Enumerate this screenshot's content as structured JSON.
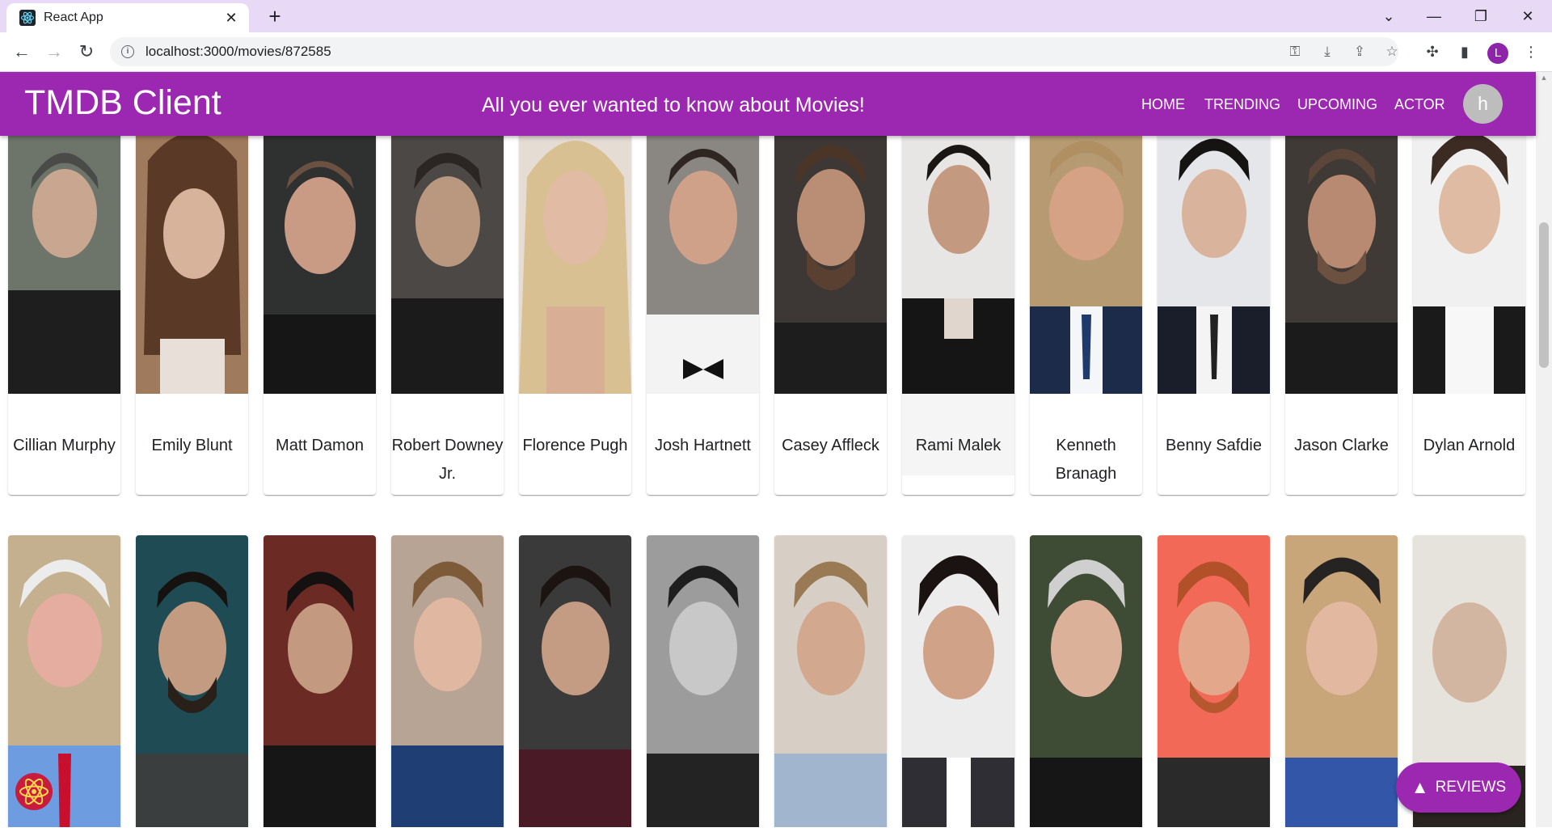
{
  "browser": {
    "tab_title": "React App",
    "url": "localhost:3000/movies/872585",
    "profile_initial": "L"
  },
  "app": {
    "brand": "TMDB Client",
    "tagline": "All you ever wanted to know about Movies!",
    "nav": [
      "Home",
      "Trending",
      "Upcoming",
      "Actor"
    ],
    "avatar_initial": "h"
  },
  "cast_row1": [
    {
      "name": "Cillian Murphy"
    },
    {
      "name": "Emily Blunt"
    },
    {
      "name": "Matt Damon"
    },
    {
      "name": "Robert Downey Jr."
    },
    {
      "name": "Florence Pugh"
    },
    {
      "name": "Josh Hartnett"
    },
    {
      "name": "Casey Affleck"
    },
    {
      "name": "Rami Malek"
    },
    {
      "name": "Kenneth Branagh"
    },
    {
      "name": "Benny Safdie"
    },
    {
      "name": "Jason Clarke"
    },
    {
      "name": "Dylan Arnold"
    }
  ],
  "fab": {
    "label": "Reviews"
  },
  "colors": {
    "primary": "#9c27b0"
  }
}
